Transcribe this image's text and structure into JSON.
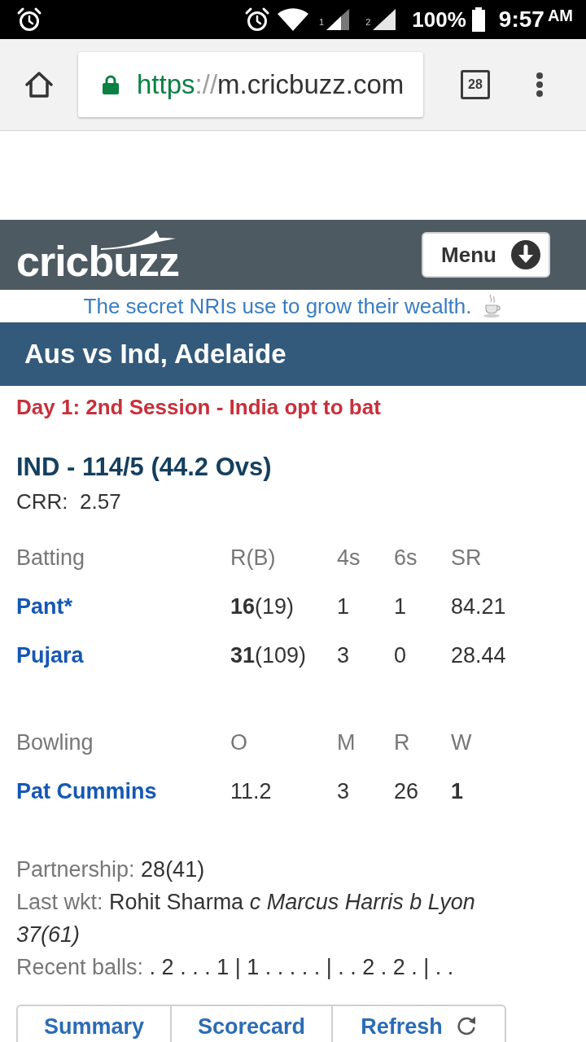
{
  "status_bar": {
    "sim_labels": [
      "1",
      "2"
    ],
    "battery": "100%",
    "time": "9:57",
    "meridiem": "AM"
  },
  "browser": {
    "url": {
      "scheme": "https",
      "separator": "://",
      "host": "m.cricbuzz.com"
    },
    "tab_count": "28"
  },
  "header": {
    "logo": "cricbuzz",
    "menu_button": "Menu"
  },
  "ad": {
    "text": "The secret NRIs use to grow their wealth."
  },
  "match": {
    "title": "Aus vs Ind, Adelaide",
    "status": "Day 1: 2nd Session - India opt to bat",
    "score": "IND - 114/5 (44.2 Ovs)",
    "crr": "CRR:  2.57"
  },
  "batting": {
    "columns": [
      "Batting",
      "R(B)",
      "4s",
      "6s",
      "SR"
    ],
    "rows": [
      {
        "cells": [
          "Pant*",
          "**16**(19)",
          "1",
          "1",
          "84.21"
        ]
      },
      {
        "cells": [
          "Pujara",
          "**31**(109)",
          "3",
          "0",
          "28.44"
        ]
      }
    ]
  },
  "bowling": {
    "columns": [
      "Bowling",
      "O",
      "M",
      "R",
      "W"
    ],
    "rows": [
      {
        "cells": [
          "Pat Cummins",
          "11.2",
          "3",
          "26",
          "1"
        ]
      }
    ]
  },
  "details": [
    {
      "label": "Partnership:",
      "value": "28(41)"
    },
    {
      "label": "Last wkt:",
      "value": "Rohit Sharma *c Marcus Harris b Lyon 37(61)*"
    },
    {
      "label": "Recent balls:",
      "value": ". 2 . . . 1 | 1 . . . . . | . . 2 . 2 . | . ."
    }
  ],
  "nav_buttons": [
    {
      "label": "Summary",
      "kind": "link"
    },
    {
      "label": "Scorecard",
      "kind": "link"
    },
    {
      "label": "Refresh",
      "kind": "refresh"
    }
  ]
}
